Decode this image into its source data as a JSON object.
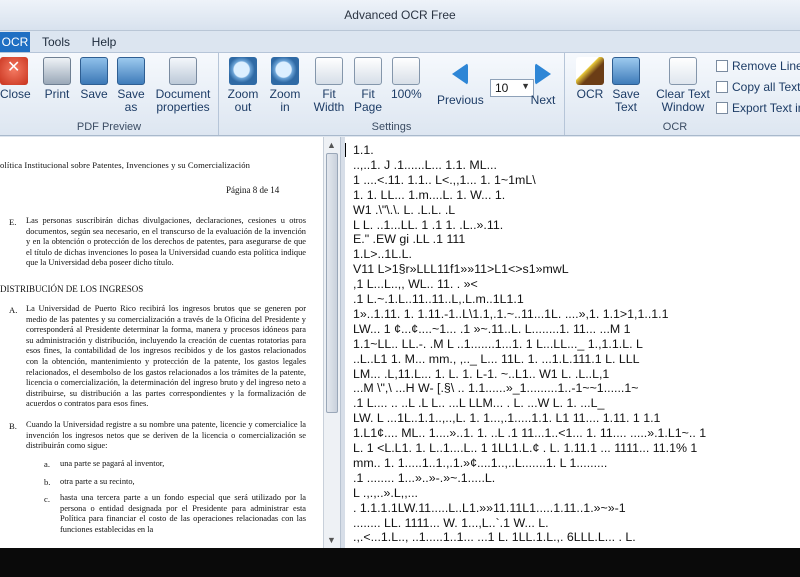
{
  "window": {
    "title": "Advanced OCR Free"
  },
  "menu": {
    "tabs": [
      "OCR",
      "Tools",
      "Help"
    ]
  },
  "ribbon": {
    "pdf_preview": {
      "label": "PDF Preview",
      "buttons": [
        "Close",
        "Print",
        "Save",
        "Save\nas",
        "Document\nproperties"
      ]
    },
    "settings": {
      "label": "Settings",
      "buttons": [
        "Zoom\nout",
        "Zoom\nin",
        "Fit\nWidth",
        "Fit\nPage",
        "100%",
        "Previous",
        "Next"
      ],
      "page_value": "10"
    },
    "ocr": {
      "label": "OCR",
      "buttons": [
        "OCR",
        "Save\nText",
        "Clear Text\nWindow"
      ],
      "small_buttons": [
        "Remove Line B",
        "Copy all Texts",
        "Export Text int"
      ]
    }
  },
  "pdf_pane": {
    "header": "olítica Institucional sobre Patentes, Invenciones y su Comercialización",
    "page_label": "Página 8 de 14",
    "para_e_marker": "E.",
    "para_e": "Las personas suscribirán dichas divulgaciones, declaraciones, cesiones u otros documentos, según sea necesario, en el transcurso de la evaluación de la invención y en la obtención o protección de los derechos de patentes, para asegurarse de que el título de dichas invenciones lo posea la Universidad cuando esta política indique que la Universidad deba poseer dicho título.",
    "heading": "DISTRIBUCIÓN DE LOS INGRESOS",
    "para_a_marker": "A.",
    "para_a": "La Universidad de Puerto Rico recibirá los ingresos brutos que se generen por medio de las patentes y su comercialización a través de la Oficina del Presidente y corresponderá al Presidente determinar la forma, manera y procesos idóneos para su administración y distribución, incluyendo la creación de cuentas rotatorias para esos fines, la contabilidad de los ingresos recibidos y de los gastos relacionados con la obtención, mantenimiento y protección de la patente, los gastos legales relacionados, el desembolso de los gastos relacionados a los trámites de la patente, licencia o comercialización, la determinación del ingreso bruto y del ingreso neto a distribuirse, su distribución a las partes correspondientes y la formalización de acuerdos o contratos para esos fines.",
    "para_b_marker": "B.",
    "para_b": "Cuando la Universidad registre a su nombre una patente, licencie y comercialice la invención los ingresos netos que se deriven de la licencia o comercialización se distribuirán como sigue:",
    "item_a_marker": "a.",
    "item_a": "una parte se pagará al inventor,",
    "item_b_marker": "b.",
    "item_b": "otra parte a su recinto,",
    "item_c_marker": "c.",
    "item_c": "hasta una tercera parte a un fondo especial que será utilizado por la persona o entidad designada por el Presidente para administrar esta Política para financiar el costo de las operaciones relacionadas con las funciones establecidas en la"
  },
  "ocr_text": [
    "1.1.",
    "..,..1. J .1......L... 1.1. ML...",
    "1 ....<.11. 1.1.. L<.,,1... 1. 1~1mL\\",
    "1. 1. LL... 1.m....L. 1. W... 1.",
    "W1 .\\\"\\.\\. L. .L.L.   .L",
    "L L. ..1...LL. 1 .1 1. .L..».11.",
    "E.\" .EW gi .LL .1 111",
    "1.L>..1L.L.",
    "V11 L>1§r»LLL11f1»»11>L1<>s1»mwL",
    ",1 L...L..,, WL.. 11. . »<",
    ".1 L.~.1.L..11..11..L,.L.m..1L1.1",
    "1»..1.11. 1. 1.11.-1..L\\1.1,.1.~..11...1L. ....»,1. 1.1>1,1..1.1",
    "LW... 1 ¢...¢....~1... .1 »~.11..L. L........1. 11... ...M 1",
    "1.1~LL.. LL.-. .M L ..1.......1...1. 1 L...LL..._ 1.,1.1.L. L",
    "..L..L1 1. M... mm., ,.._ L... 11L. 1. ...1.L.111.1 L. LLL",
    "LM... .L,11.L... 1. L. 1. L-1. ~..L1.. W1 L. .L..L,1",
    "...M \\\",\\ ...H W- [.§\\ .. 1.1......»_1.........1..-1~~1......1~",
    ".1 L.... .. ..L .L L.. ...L LLM... . L. ...W L. 1. ...L_",
    "LW. L ...1L..1.1..,..,L. 1. 1...,.1.....1.1. L1 11.... 1.11. 1 1.1",
    "1.L1¢.... ML.. 1....»..1. 1. ..L .1 11...1..<1... 1. 11.... .....».1.L1~.. 1",
    "L. 1 <L.L1. 1. L..1....L.. 1 1LL1.L.¢ . L. 1.11.1 ... 1111... 11.1% 1",
    "mm.. 1. 1.....1..1.,.1.»¢....1..,..L.......1. L 1.........",
    ".1 ........ 1...»..»-.»~.1.....L.",
    "L .,.,..».L,,...",
    ". 1.1.1.1LW.11.....L..L1.»»11.11L1.....1.11..1.»~»-1",
    "........ LL. 1111... W. 1...,L..`.1 W... L.",
    ".,.<...1.L.., ..1.....1..1... ...1 L. 1LL.1.L.,. 6LLL.L... . L."
  ]
}
